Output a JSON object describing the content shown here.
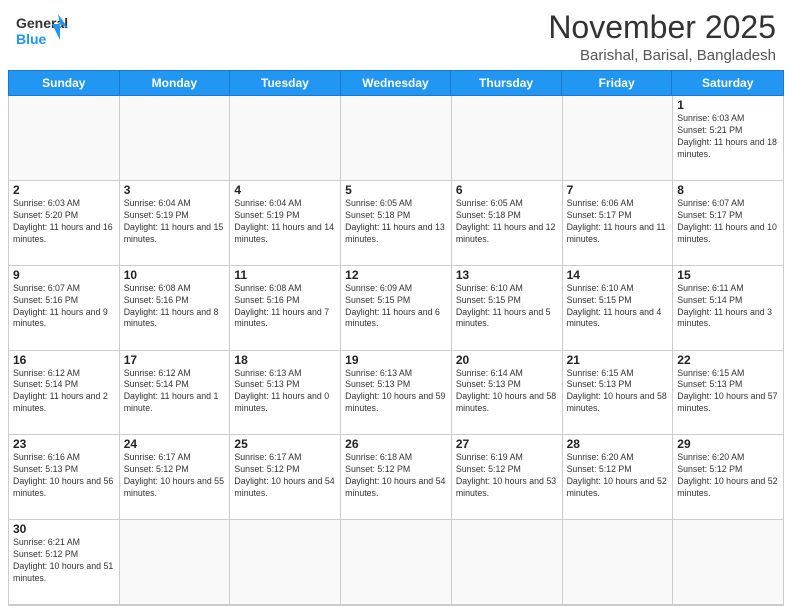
{
  "header": {
    "logo_general": "General",
    "logo_blue": "Blue",
    "month_title": "November 2025",
    "subtitle": "Barishal, Barisal, Bangladesh"
  },
  "weekdays": [
    "Sunday",
    "Monday",
    "Tuesday",
    "Wednesday",
    "Thursday",
    "Friday",
    "Saturday"
  ],
  "weeks": [
    [
      {
        "day": "",
        "info": ""
      },
      {
        "day": "",
        "info": ""
      },
      {
        "day": "",
        "info": ""
      },
      {
        "day": "",
        "info": ""
      },
      {
        "day": "",
        "info": ""
      },
      {
        "day": "",
        "info": ""
      },
      {
        "day": "1",
        "info": "Sunrise: 6:03 AM\nSunset: 5:21 PM\nDaylight: 11 hours and 18 minutes."
      }
    ],
    [
      {
        "day": "2",
        "info": "Sunrise: 6:03 AM\nSunset: 5:20 PM\nDaylight: 11 hours and 16 minutes."
      },
      {
        "day": "3",
        "info": "Sunrise: 6:04 AM\nSunset: 5:19 PM\nDaylight: 11 hours and 15 minutes."
      },
      {
        "day": "4",
        "info": "Sunrise: 6:04 AM\nSunset: 5:19 PM\nDaylight: 11 hours and 14 minutes."
      },
      {
        "day": "5",
        "info": "Sunrise: 6:05 AM\nSunset: 5:18 PM\nDaylight: 11 hours and 13 minutes."
      },
      {
        "day": "6",
        "info": "Sunrise: 6:05 AM\nSunset: 5:18 PM\nDaylight: 11 hours and 12 minutes."
      },
      {
        "day": "7",
        "info": "Sunrise: 6:06 AM\nSunset: 5:17 PM\nDaylight: 11 hours and 11 minutes."
      },
      {
        "day": "8",
        "info": "Sunrise: 6:07 AM\nSunset: 5:17 PM\nDaylight: 11 hours and 10 minutes."
      }
    ],
    [
      {
        "day": "9",
        "info": "Sunrise: 6:07 AM\nSunset: 5:16 PM\nDaylight: 11 hours and 9 minutes."
      },
      {
        "day": "10",
        "info": "Sunrise: 6:08 AM\nSunset: 5:16 PM\nDaylight: 11 hours and 8 minutes."
      },
      {
        "day": "11",
        "info": "Sunrise: 6:08 AM\nSunset: 5:16 PM\nDaylight: 11 hours and 7 minutes."
      },
      {
        "day": "12",
        "info": "Sunrise: 6:09 AM\nSunset: 5:15 PM\nDaylight: 11 hours and 6 minutes."
      },
      {
        "day": "13",
        "info": "Sunrise: 6:10 AM\nSunset: 5:15 PM\nDaylight: 11 hours and 5 minutes."
      },
      {
        "day": "14",
        "info": "Sunrise: 6:10 AM\nSunset: 5:15 PM\nDaylight: 11 hours and 4 minutes."
      },
      {
        "day": "15",
        "info": "Sunrise: 6:11 AM\nSunset: 5:14 PM\nDaylight: 11 hours and 3 minutes."
      }
    ],
    [
      {
        "day": "16",
        "info": "Sunrise: 6:12 AM\nSunset: 5:14 PM\nDaylight: 11 hours and 2 minutes."
      },
      {
        "day": "17",
        "info": "Sunrise: 6:12 AM\nSunset: 5:14 PM\nDaylight: 11 hours and 1 minute."
      },
      {
        "day": "18",
        "info": "Sunrise: 6:13 AM\nSunset: 5:13 PM\nDaylight: 11 hours and 0 minutes."
      },
      {
        "day": "19",
        "info": "Sunrise: 6:13 AM\nSunset: 5:13 PM\nDaylight: 10 hours and 59 minutes."
      },
      {
        "day": "20",
        "info": "Sunrise: 6:14 AM\nSunset: 5:13 PM\nDaylight: 10 hours and 58 minutes."
      },
      {
        "day": "21",
        "info": "Sunrise: 6:15 AM\nSunset: 5:13 PM\nDaylight: 10 hours and 58 minutes."
      },
      {
        "day": "22",
        "info": "Sunrise: 6:15 AM\nSunset: 5:13 PM\nDaylight: 10 hours and 57 minutes."
      }
    ],
    [
      {
        "day": "23",
        "info": "Sunrise: 6:16 AM\nSunset: 5:13 PM\nDaylight: 10 hours and 56 minutes."
      },
      {
        "day": "24",
        "info": "Sunrise: 6:17 AM\nSunset: 5:12 PM\nDaylight: 10 hours and 55 minutes."
      },
      {
        "day": "25",
        "info": "Sunrise: 6:17 AM\nSunset: 5:12 PM\nDaylight: 10 hours and 54 minutes."
      },
      {
        "day": "26",
        "info": "Sunrise: 6:18 AM\nSunset: 5:12 PM\nDaylight: 10 hours and 54 minutes."
      },
      {
        "day": "27",
        "info": "Sunrise: 6:19 AM\nSunset: 5:12 PM\nDaylight: 10 hours and 53 minutes."
      },
      {
        "day": "28",
        "info": "Sunrise: 6:20 AM\nSunset: 5:12 PM\nDaylight: 10 hours and 52 minutes."
      },
      {
        "day": "29",
        "info": "Sunrise: 6:20 AM\nSunset: 5:12 PM\nDaylight: 10 hours and 52 minutes."
      }
    ],
    [
      {
        "day": "30",
        "info": "Sunrise: 6:21 AM\nSunset: 5:12 PM\nDaylight: 10 hours and 51 minutes."
      },
      {
        "day": "",
        "info": ""
      },
      {
        "day": "",
        "info": ""
      },
      {
        "day": "",
        "info": ""
      },
      {
        "day": "",
        "info": ""
      },
      {
        "day": "",
        "info": ""
      },
      {
        "day": "",
        "info": ""
      }
    ]
  ]
}
